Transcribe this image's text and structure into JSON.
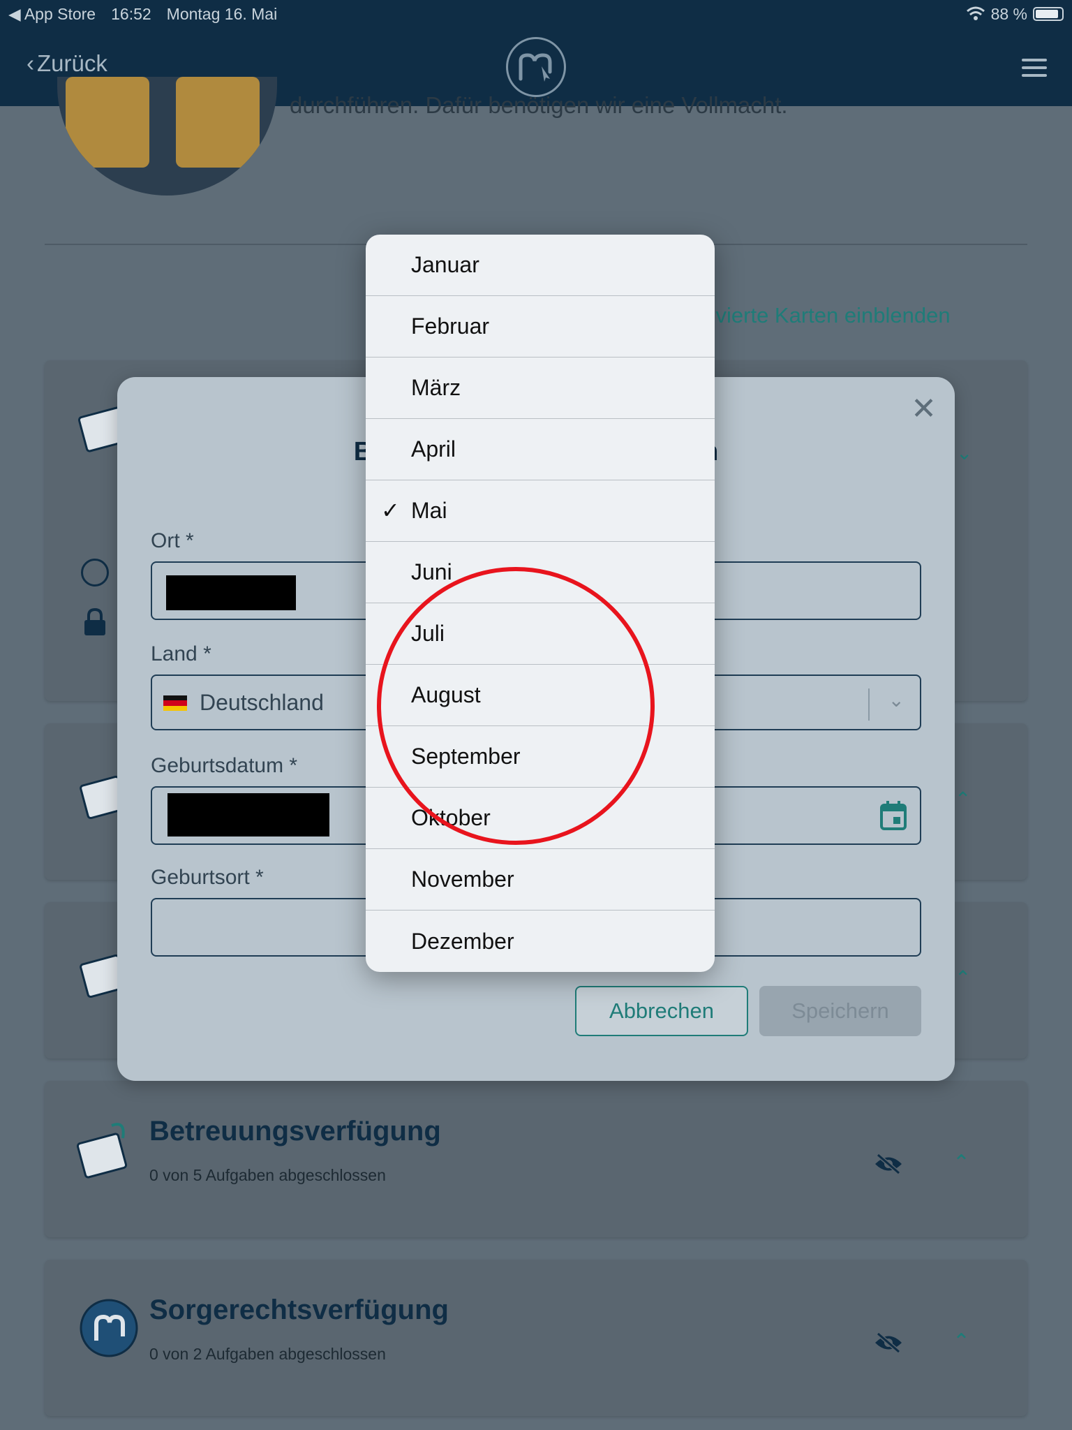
{
  "status_bar": {
    "back_app": "App Store",
    "time": "16:52",
    "date": "Montag 16. Mai",
    "battery": "88 %",
    "battery_level": 0.88
  },
  "nav": {
    "back_label": "Zurück",
    "logo_icon": "app-logo",
    "menu_icon": "hamburger-icon"
  },
  "background": {
    "intro_text": "durchführen. Dafür benötigen wir eine Vollmacht.",
    "link": "tivierte Karten einblenden",
    "cards": [
      {
        "title": "Betreuungsverfügung",
        "subtitle": "0 von 5 Aufgaben abgeschlossen"
      },
      {
        "title": "Sorgerechtsverfügung",
        "subtitle": "0 von 2 Aufgaben abgeschlossen"
      }
    ]
  },
  "modal": {
    "title_left": "Benu",
    "title_right": "gen",
    "fields": {
      "ort_label": "Ort *",
      "land_label": "Land *",
      "land_value": "Deutschland",
      "geburtsdatum_label": "Geburtsdatum *",
      "geburtsort_label": "Geburtsort *"
    },
    "cancel_label": "Abbrechen",
    "save_label": "Speichern"
  },
  "picker": {
    "months": [
      "Januar",
      "Februar",
      "März",
      "April",
      "Mai",
      "Juni",
      "Juli",
      "August",
      "September",
      "Oktober",
      "November",
      "Dezember"
    ],
    "selected": "Mai",
    "check_glyph": "✓"
  },
  "colors": {
    "navy": "#0f2d45",
    "teal": "#1f7c78",
    "annotation_red": "#e8141d"
  }
}
